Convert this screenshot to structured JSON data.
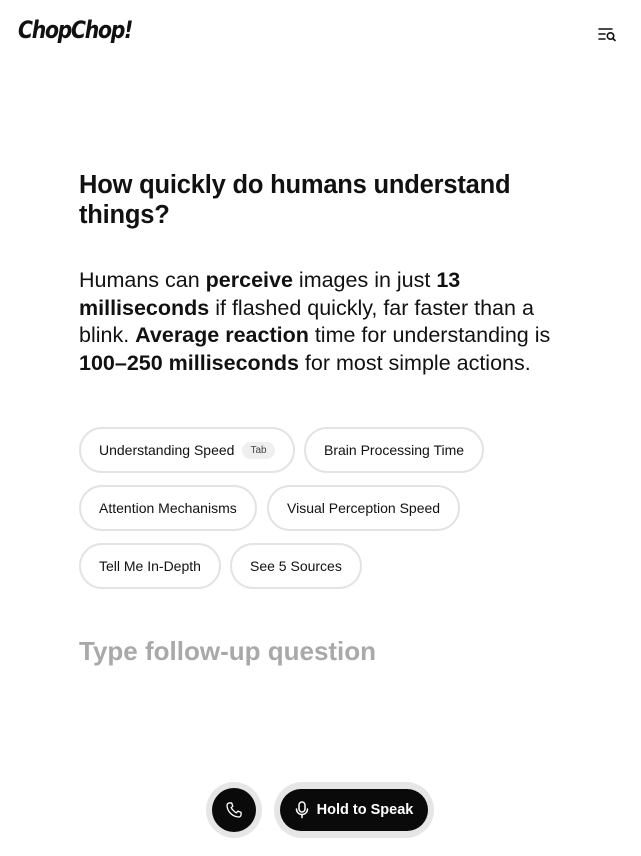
{
  "header": {
    "logo": "ChopChop!",
    "menu_icon": "menu-search-icon"
  },
  "question": "How quickly do humans understand things?",
  "answer": {
    "parts": [
      {
        "text": "Humans can ",
        "bold": false
      },
      {
        "text": "perceive",
        "bold": true
      },
      {
        "text": " images in just ",
        "bold": false
      },
      {
        "text": "13 milliseconds",
        "bold": true
      },
      {
        "text": " if flashed quickly, far faster than a blink. ",
        "bold": false
      },
      {
        "text": "Average reaction",
        "bold": true
      },
      {
        "text": " time for understanding is ",
        "bold": false
      },
      {
        "text": "100–250 milliseconds",
        "bold": true
      },
      {
        "text": " for most simple actions.",
        "bold": false
      }
    ]
  },
  "suggestions": [
    {
      "label": "Understanding Speed",
      "shortcut": "Tab"
    },
    {
      "label": "Brain Processing Time"
    },
    {
      "label": "Attention Mechanisms"
    },
    {
      "label": "Visual Perception Speed"
    },
    {
      "label": "Tell Me In-Depth"
    },
    {
      "label": "See 5 Sources"
    }
  ],
  "followup": {
    "placeholder": "Type follow-up question",
    "value": ""
  },
  "footer": {
    "call_icon": "phone-icon",
    "speak_icon": "microphone-icon",
    "speak_label": "Hold to Speak"
  },
  "colors": {
    "button_bg": "#0a0a0a",
    "chip_border": "#e3e3e3",
    "placeholder": "#a9a9a9"
  }
}
